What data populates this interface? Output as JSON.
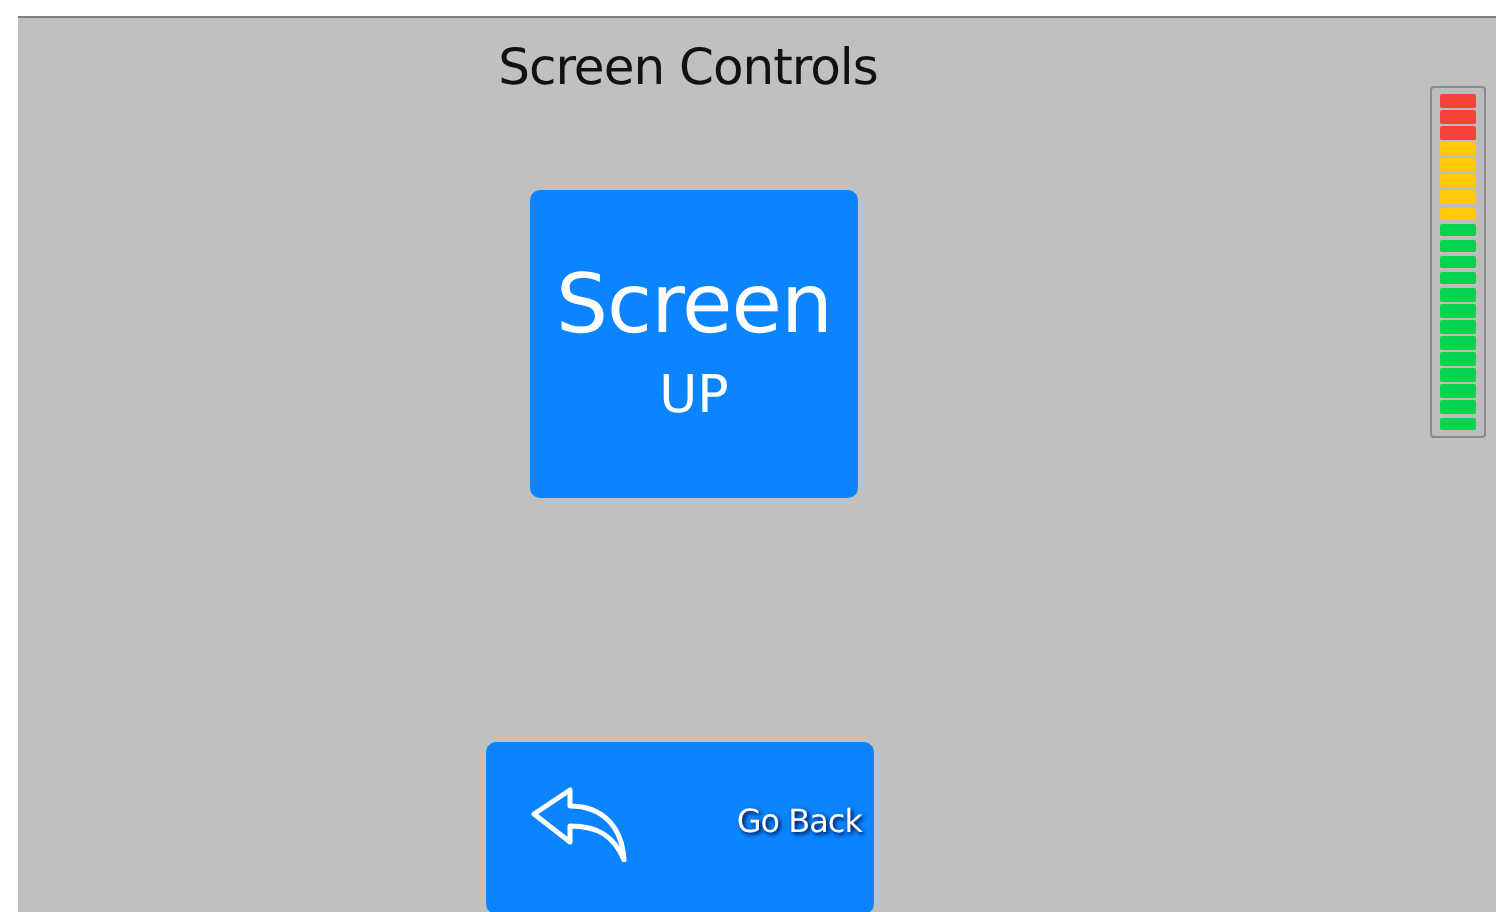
{
  "title": "Screen Controls",
  "screen_button": {
    "label": "Screen",
    "sublabel": "UP"
  },
  "back_button": {
    "label": "Go Back"
  }
}
